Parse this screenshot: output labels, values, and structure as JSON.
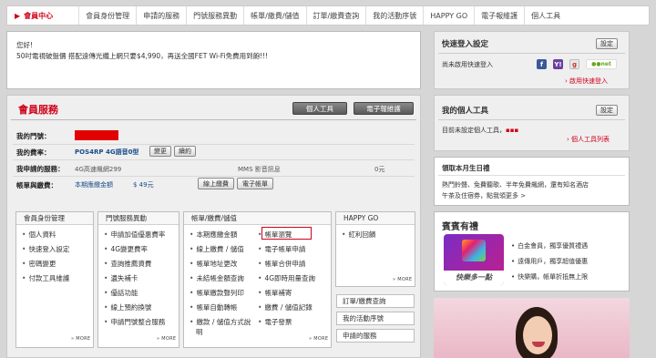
{
  "topnav": {
    "active": "會員中心",
    "items": [
      "會員身份管理",
      "申請的服務",
      "門號服務異動",
      "帳單/繳費/儲值",
      "訂單/繳費查詢",
      "我的活動序號",
      "HAPPY GO",
      "電子報維護",
      "個人工具"
    ]
  },
  "news": {
    "greeting": "您好!",
    "message": "50吋電視破盤價 搭配遠傳光纖上網只要$4,990，再送全國FET Wi-Fi免費用到飽!!!"
  },
  "member": {
    "title": "會員服務",
    "btn_tools": "個人工具",
    "btn_newsletter": "電子報維護",
    "label_phone": "我的門號：",
    "label_plan": "我的費率：",
    "plan_value": "POS4RP 4G語音0型",
    "btn_change": "變更",
    "btn_renew": "續約",
    "label_services": "我申請的服務：",
    "service1": "4G高速飆網299",
    "service2": "MMS 影音訊息",
    "service2_price": "0元",
    "label_bill": "帳單與繳費：",
    "bill_text": "本期應繳金額",
    "bill_amount": "$ 49元",
    "btn_pay": "線上繳費",
    "btn_ebill": "電子帳單",
    "more": "MORE"
  },
  "columns": [
    {
      "head": "會員身份管理",
      "items": [
        "個人資料",
        "快速登入設定",
        "密碼變更",
        "付款工具維護"
      ]
    },
    {
      "head": "門號服務異動",
      "items": [
        "申請加值優惠費率",
        "4G變更費率",
        "查詢推薦資費",
        "遺失補卡",
        "優話功能",
        "線上預約換號",
        "申請門號整合服務"
      ]
    },
    {
      "head": "帳單/繳費/儲值",
      "items_left": [
        "本期應繳金額",
        "線上繳費 / 儲值",
        "帳單地址更改",
        "未結帳金額查詢",
        "帳單繳款聲列印",
        "帳單自動轉帳",
        "繳款 / 儲值方式說明"
      ],
      "items_right": [
        "帳單瀏覽",
        "電子帳單申請",
        "帳單合併申請",
        "4G即時用量查詢",
        "帳單補寄",
        "繳費 / 儲值記錄",
        "電子發票"
      ]
    },
    {
      "head": "HAPPY GO",
      "items": [
        "紅利回饋"
      ]
    }
  ],
  "side_buttons": [
    "訂單/繳費查詢",
    "我的活動序號",
    "申請的服務"
  ],
  "quick_login": {
    "title": "快速登入設定",
    "btn": "設定",
    "text": "尚未啟用快速登入",
    "link": "啟用快速登入"
  },
  "tools": {
    "title": "我的個人工具",
    "btn": "設定",
    "text": "目前未設定個人工具，",
    "link": "個人工具列表"
  },
  "birthday": {
    "title": "領取本月生日禮",
    "text1": "熱門鈴聲、免費聽歌、半年免費飆網，還有知名酒店",
    "text2": "午茶及住宿券，點我領更多 >"
  },
  "gift": {
    "title": "賓賓有禮",
    "card_text": "快樂多一點",
    "items": [
      "白金會員，獨享優質禮遇",
      "遠傳用戶，獨享超值優惠",
      "快樂購，帳單折抵無上限"
    ]
  },
  "colors": {
    "accent": "#d0021b",
    "link": "#1a4d8a"
  }
}
